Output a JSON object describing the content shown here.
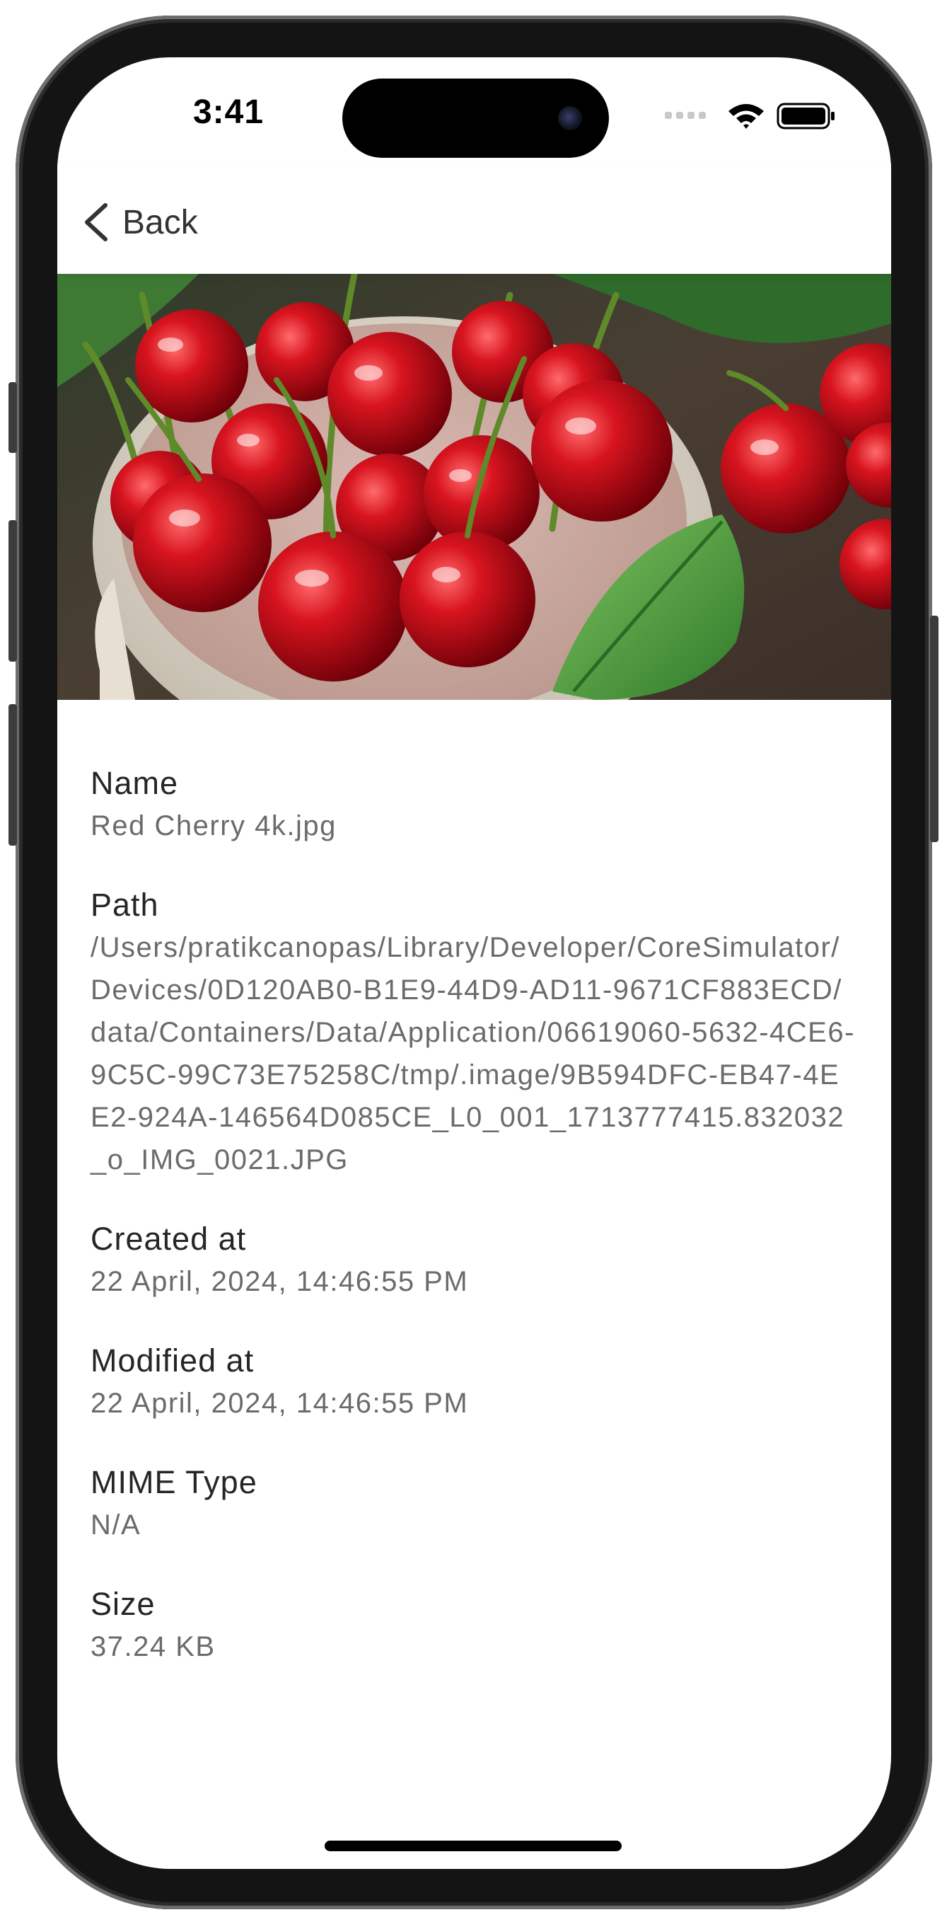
{
  "status_bar": {
    "time": "3:41",
    "wifi_icon": "wifi-icon",
    "battery_icon": "battery-icon",
    "signal_icon": "cellular-signal-icon"
  },
  "nav": {
    "back_label": "Back",
    "back_icon": "chevron-left-icon"
  },
  "image": {
    "subject": "Red cherries in a white bowl with green leaves",
    "icon": "photo-preview"
  },
  "details": [
    {
      "label": "Name",
      "value": "Red Cherry 4k.jpg"
    },
    {
      "label": "Path",
      "value": "/Users/pratikcanopas/Library/Developer/CoreSimulator/Devices/0D120AB0-B1E9-44D9-AD11-9671CF883ECD/data/Containers/Data/Application/06619060-5632-4CE6-9C5C-99C73E75258C/tmp/.image/9B594DFC-EB47-4EE2-924A-146564D085CE_L0_001_1713777415.832032_o_IMG_0021.JPG"
    },
    {
      "label": "Created at",
      "value": "22 April, 2024, 14:46:55 PM"
    },
    {
      "label": "Modified at",
      "value": "22 April, 2024, 14:46:55 PM"
    },
    {
      "label": "MIME Type",
      "value": "N/A"
    },
    {
      "label": "Size",
      "value": "37.24 KB"
    }
  ],
  "colors": {
    "frame": "#141414",
    "screen_bg": "#ffffff",
    "label_text": "#262626",
    "value_text": "#6b6b6b",
    "cherry_red": "#c4101a",
    "leaf_green": "#4a9a3a"
  }
}
